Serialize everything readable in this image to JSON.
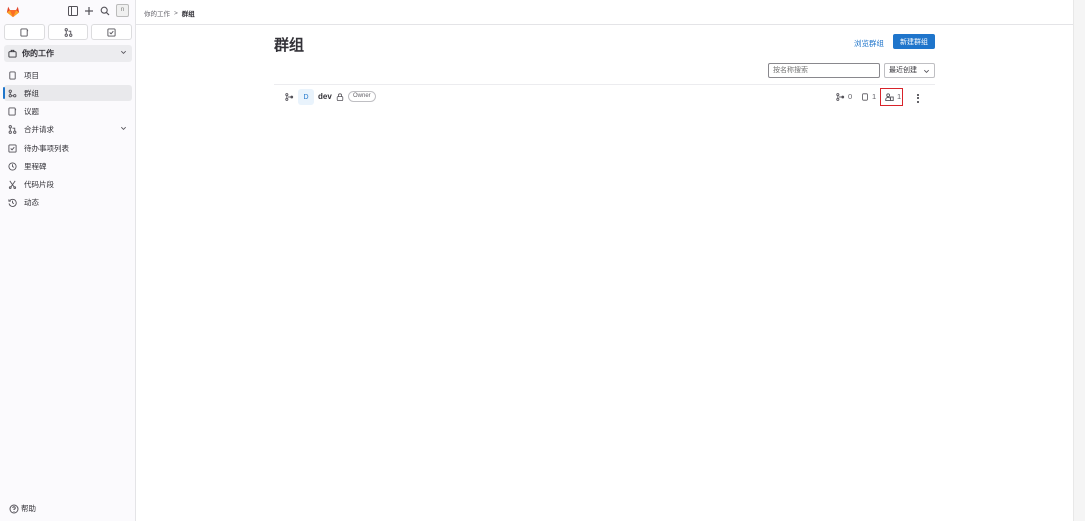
{
  "avatar_alt": "n",
  "sidebar": {
    "context_label": "你的工作",
    "items": [
      {
        "label": "项目",
        "icon": "project-icon"
      },
      {
        "label": "群组",
        "icon": "group-icon",
        "active": true
      },
      {
        "label": "议题",
        "icon": "issues-icon"
      },
      {
        "label": "合并请求",
        "icon": "merge-request-icon",
        "has_chevron": true
      },
      {
        "label": "待办事项列表",
        "icon": "todo-icon"
      },
      {
        "label": "里程碑",
        "icon": "milestone-icon"
      },
      {
        "label": "代码片段",
        "icon": "snippet-icon"
      },
      {
        "label": "动态",
        "icon": "activity-icon"
      }
    ],
    "help_label": "帮助"
  },
  "breadcrumb": {
    "parent": "你的工作",
    "separator": ">",
    "current": "群组"
  },
  "page": {
    "title": "群组",
    "explore_link": "浏览群组",
    "new_group_button": "新建群组",
    "search_placeholder": "按名称搜索",
    "sort_label": "最近创建"
  },
  "groups": [
    {
      "avatar_letter": "D",
      "name": "dev",
      "role": "Owner",
      "subgroups": "0",
      "projects": "1",
      "members": "1"
    }
  ],
  "colors": {
    "accent": "#1f75cb",
    "highlight": "#d8232a",
    "logo": "#e24329"
  }
}
